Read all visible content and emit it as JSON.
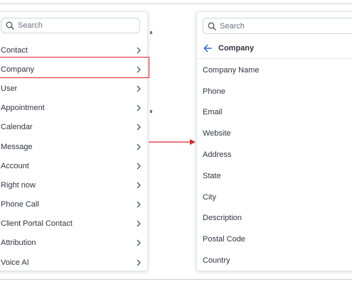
{
  "left_panel": {
    "search_placeholder": "Search",
    "items": [
      {
        "label": "Contact"
      },
      {
        "label": "Company"
      },
      {
        "label": "User"
      },
      {
        "label": "Appointment"
      },
      {
        "label": "Calendar"
      },
      {
        "label": "Message"
      },
      {
        "label": "Account"
      },
      {
        "label": "Right now"
      },
      {
        "label": "Phone Call"
      },
      {
        "label": "Client Portal Contact"
      },
      {
        "label": "Attribution"
      },
      {
        "label": "Voice AI"
      }
    ],
    "highlighted_item": "Company"
  },
  "right_panel": {
    "search_placeholder": "Search",
    "header_title": "Company",
    "fields": [
      {
        "label": "Company Name"
      },
      {
        "label": "Phone"
      },
      {
        "label": "Email"
      },
      {
        "label": "Website"
      },
      {
        "label": "Address"
      },
      {
        "label": "State"
      },
      {
        "label": "City"
      },
      {
        "label": "Description"
      },
      {
        "label": "Postal Code"
      },
      {
        "label": "Country"
      }
    ]
  },
  "colors": {
    "highlight": "#d9262e",
    "accent": "#2563eb",
    "text": "#2f3541"
  },
  "icons": {
    "search": "search-icon",
    "chevron": "chevron-right-icon",
    "back": "arrow-left-icon",
    "connector": "arrow-right-icon"
  }
}
